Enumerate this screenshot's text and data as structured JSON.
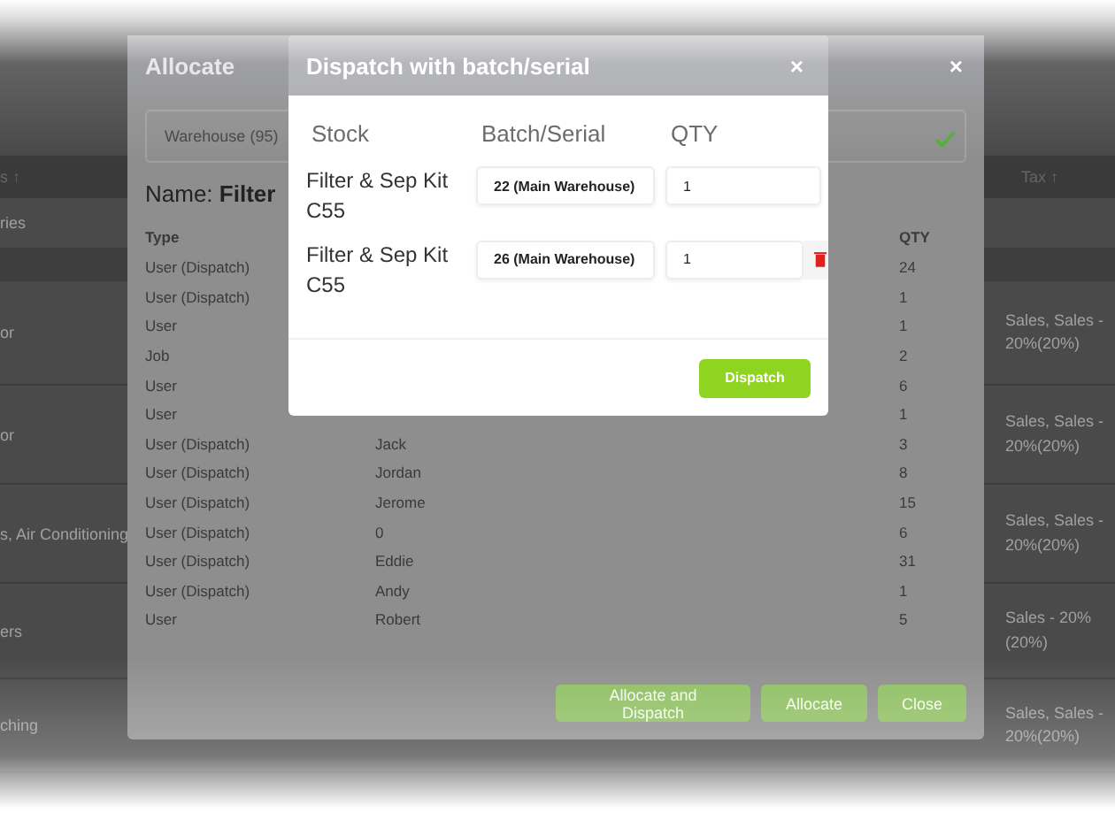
{
  "page": {
    "left_header": "s ↑",
    "right_header": "Tax ↑",
    "left_cells": [
      "ries",
      "",
      "or",
      "or",
      "s, Air Conditioning",
      "ers",
      "ching"
    ],
    "right_cells": [
      "",
      "",
      "Sales, Sales - 20%(20%)",
      "Sales, Sales - 20%(20%)",
      "Sales, Sales - 20%(20%)",
      "Sales - 20% (20%)",
      "Sales, Sales - 20%(20%)"
    ]
  },
  "allocate_modal": {
    "title": "Allocate",
    "close": "×",
    "field_value": "Warehouse (95)",
    "name_label": "Name:",
    "name_value": "Filter",
    "columns": [
      "Type",
      "QTY"
    ],
    "rows": [
      {
        "type": "User (Dispatch)",
        "qty": "24"
      },
      {
        "type": "User (Dispatch)",
        "qty": "1"
      },
      {
        "type": "User",
        "qty": "1"
      },
      {
        "type": "Job",
        "qty": "2"
      },
      {
        "type": "User",
        "qty": "6"
      },
      {
        "type": "User",
        "qty": "1"
      },
      {
        "type": "User (Dispatch)",
        "name": "Jack",
        "qty": "3"
      },
      {
        "type": "User (Dispatch)",
        "name": "Jordan",
        "qty": "8"
      },
      {
        "type": "User (Dispatch)",
        "name": "Jerome",
        "qty": "15"
      },
      {
        "type": "User (Dispatch)",
        "name": "0",
        "qty": "6"
      },
      {
        "type": "User (Dispatch)",
        "name": "Eddie",
        "qty": "31"
      },
      {
        "type": "User (Dispatch)",
        "name": "Andy",
        "qty": "1"
      },
      {
        "type": "User",
        "name": "Robert",
        "qty": "5"
      }
    ],
    "buttons": [
      "Allocate and Dispatch",
      "Allocate",
      "Close"
    ]
  },
  "dispatch_modal": {
    "title": "Dispatch with batch/serial",
    "close": "×",
    "columns": [
      "Stock",
      "Batch/Serial",
      "QTY"
    ],
    "rows": [
      {
        "stock": "Filter & Sep Kit C55",
        "batch": "22 (Main Warehouse)",
        "qty": "1",
        "removable": false
      },
      {
        "stock": "Filter & Sep Kit C55",
        "batch": "26 (Main Warehouse)",
        "qty": "1",
        "removable": true
      }
    ],
    "button": "Dispatch"
  }
}
